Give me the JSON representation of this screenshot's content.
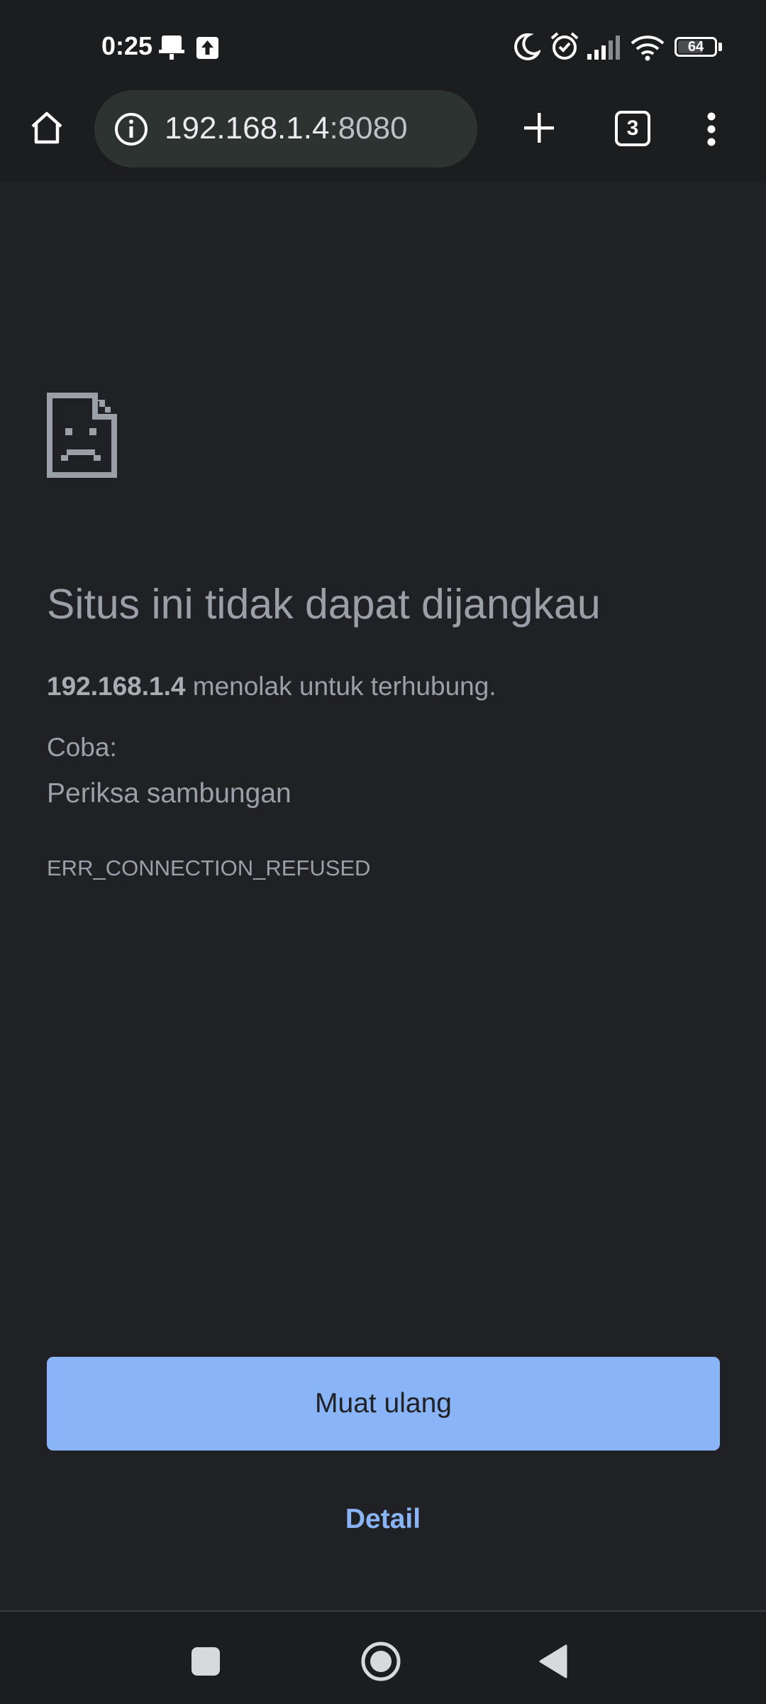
{
  "status_bar": {
    "time": "0:25",
    "battery_level": "64",
    "icons": [
      "notification-bell-icon",
      "upload-icon",
      "do-not-disturb-moon-icon",
      "alarm-icon",
      "signal-icon",
      "wifi-icon",
      "battery-icon"
    ]
  },
  "toolbar": {
    "url_host": "192.168.1.4",
    "url_port": ":8080",
    "tab_count": "3",
    "icons": [
      "home-icon",
      "site-info-icon",
      "new-tab-plus-icon",
      "tab-switcher-icon",
      "overflow-menu-icon"
    ]
  },
  "error_page": {
    "title": "Situs ini tidak dapat dijangkau",
    "host": "192.168.1.4",
    "description_suffix": " menolak untuk terhubung.",
    "try_label": "Coba:",
    "suggestion": "Periksa sambungan",
    "error_code": "ERR_CONNECTION_REFUSED",
    "reload_label": "Muat ulang",
    "details_label": "Detail"
  },
  "nav_bar": {
    "icons": [
      "recents-square-icon",
      "home-circle-icon",
      "back-triangle-icon"
    ]
  },
  "colors": {
    "background": "#202124",
    "bar_background": "#1c1d1f",
    "omnibox": "#2d3330",
    "text_muted": "#9aa0a6",
    "accent_blue": "#8ab4f8"
  }
}
